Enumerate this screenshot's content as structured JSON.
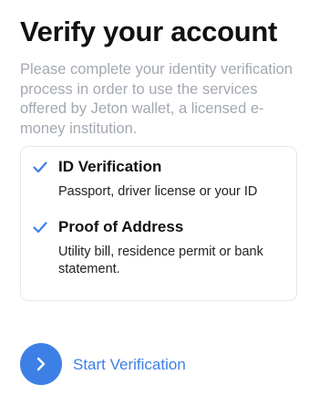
{
  "header": {
    "title": "Verify your account",
    "description": "Please complete your identity verification process in order to use the services offered by Jeton wallet, a licensed e-money institution."
  },
  "requirements": [
    {
      "icon": "checkmark-icon",
      "title": "ID Verification",
      "description": "Passport, driver license or your ID"
    },
    {
      "icon": "checkmark-icon",
      "title": "Proof of Address",
      "description": "Utility bill, residence permit or bank statement."
    }
  ],
  "action": {
    "icon": "chevron-right-icon",
    "label": "Start Verification"
  },
  "colors": {
    "accent": "#3c80e6",
    "title_text": "#111111",
    "muted_text": "#a3a8b1",
    "card_border": "#e5e7eb"
  }
}
